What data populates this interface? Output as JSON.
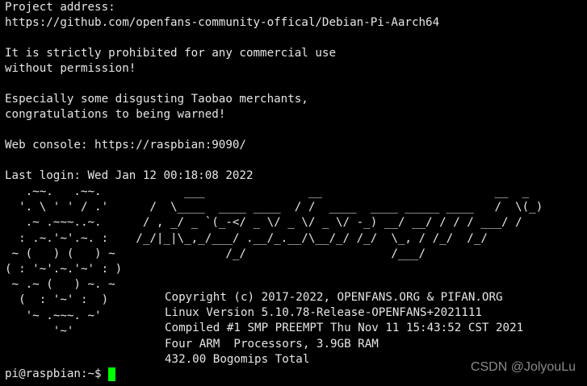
{
  "terminal": {
    "lines": [
      "Project address:",
      "https://github.com/openfans-community-offical/Debian-Pi-Aarch64",
      "",
      "It is strictly prohibited for any commercial use",
      "without permission!",
      "",
      "Especially some disgusting Taobao merchants,",
      "congratulations to being warned!",
      "",
      "Web console: https://raspbian:9090/",
      "",
      "Last login: Wed Jan 12 00:18:08 2022"
    ],
    "banner_art": "   .~~.   .~~.            ___               __                         __  _\n  '. \\ ' ' / .'      /  \\____  ____ ____  / /  ____  ____ _____ ____   /  \\(_)\n   .~ .~~~..~.      / , _/ _ `(_-</ _ \\/ _ \\/ _ \\/ -_) __/ __/ / / / ___/ /\n  : .~.'~'.~. :    /_/|_|\\_,_/___/ .__/_.__/\\__/_/ /_/  \\_, / /_/  /_/\n ~ (   ) (   ) ~                /_/                     /___/\n( : '~'.~.'~' : )\n ~ .~ (   ) ~. ~\n  (  : '~' :  )\n   '~ .~~~. ~'\n       '~'",
    "sysinfo": [
      "Copyright (c) 2017-2022, OPENFANS.ORG & PIFAN.ORG",
      "Linux Version 5.10.78-Release-OPENFANS+2021111",
      "Compiled #1 SMP PREEMPT Thu Nov 11 15:43:52 CST 2021",
      "Four ARM  Processors, 3.9GB RAM",
      "432.00 Bogomips Total"
    ],
    "prompt": "pi@raspbian:~$ ",
    "cursor_color": "#00ff00",
    "background_color": "#000000",
    "text_color": "#e6e6e6"
  },
  "watermark": {
    "text": "CSDN @JolyouLu"
  }
}
